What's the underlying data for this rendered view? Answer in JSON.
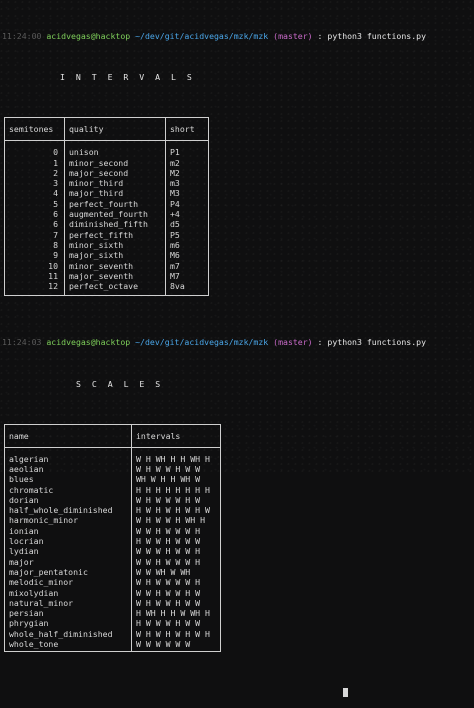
{
  "prompts": [
    {
      "time": "11:24:00",
      "user": "acidvegas@hacktop",
      "path": "~/dev/git/acidvegas/mzk/mzk",
      "branch": "(master)",
      "sep": ":",
      "cmd": "python3 functions.py"
    },
    {
      "time": "11:24:03",
      "user": "acidvegas@hacktop",
      "path": "~/dev/git/acidvegas/mzk/mzk",
      "branch": "(master)",
      "sep": ":",
      "cmd": "python3 functions.py"
    }
  ],
  "intervals": {
    "title": "I N T E R V A L S",
    "headers": [
      "semitones",
      "quality",
      "short"
    ],
    "rows": [
      [
        "0",
        "unison",
        "P1"
      ],
      [
        "1",
        "minor_second",
        "m2"
      ],
      [
        "2",
        "major_second",
        "M2"
      ],
      [
        "3",
        "minor_third",
        "m3"
      ],
      [
        "4",
        "major_third",
        "M3"
      ],
      [
        "5",
        "perfect_fourth",
        "P4"
      ],
      [
        "6",
        "augmented_fourth",
        "+4"
      ],
      [
        "6",
        "diminished_fifth",
        "d5"
      ],
      [
        "7",
        "perfect_fifth",
        "P5"
      ],
      [
        "8",
        "minor_sixth",
        "m6"
      ],
      [
        "9",
        "major_sixth",
        "M6"
      ],
      [
        "10",
        "minor_seventh",
        "m7"
      ],
      [
        "11",
        "major_seventh",
        "M7"
      ],
      [
        "12",
        "perfect_octave",
        "8va"
      ]
    ]
  },
  "scales": {
    "title": "S C A L E S",
    "headers": [
      "name",
      "intervals"
    ],
    "rows": [
      [
        "algerian",
        "W H WH H H WH H"
      ],
      [
        "aeolian",
        "W H W W H W W"
      ],
      [
        "blues",
        "WH W H H WH W"
      ],
      [
        "chromatic",
        "H H H H H H H H"
      ],
      [
        "dorian",
        "W H W W W H W"
      ],
      [
        "half_whole_diminished",
        "H W H W H W H W"
      ],
      [
        "harmonic_minor",
        "W H W W H WH H"
      ],
      [
        "ionian",
        "W W H W W W H"
      ],
      [
        "locrian",
        "H W W H W W W"
      ],
      [
        "lydian",
        "W W W H W W H"
      ],
      [
        "major",
        "W W H W W W H"
      ],
      [
        "major_pentatonic",
        "W W WH W WH"
      ],
      [
        "melodic_minor",
        "W H W W W W H"
      ],
      [
        "mixolydian",
        "W W H W W H W"
      ],
      [
        "natural_minor",
        "W H W W H W W"
      ],
      [
        "persian",
        "H WH H H W WH H"
      ],
      [
        "phrygian",
        "H W W W H W W"
      ],
      [
        "whole_half_diminished",
        "W H W H W H W H"
      ],
      [
        "whole_tone",
        "W W W W W W"
      ]
    ]
  }
}
